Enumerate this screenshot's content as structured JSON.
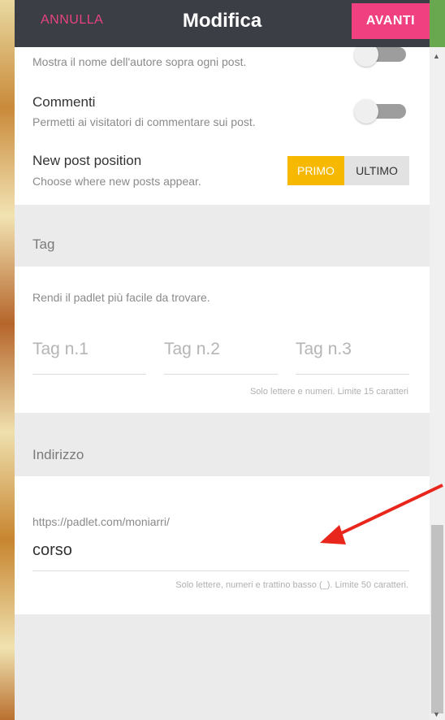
{
  "header": {
    "cancel_label": "ANNULLA",
    "title": "Modifica",
    "next_label": "AVANTI"
  },
  "settings": {
    "author_desc": "Mostra il nome dell'autore sopra ogni post.",
    "comments_title": "Commenti",
    "comments_desc": "Permetti ai visitatori di commentare sui post.",
    "position_title": "New post position",
    "position_desc": "Choose where new posts appear.",
    "position_options": [
      "PRIMO",
      "ULTIMO"
    ],
    "position_selected": "PRIMO"
  },
  "tags": {
    "section_label": "Tag",
    "desc": "Rendi il padlet più facile da trovare.",
    "placeholders": [
      "Tag n.1",
      "Tag n.2",
      "Tag n.3"
    ],
    "hint": "Solo lettere e numeri. Limite 15 caratteri"
  },
  "address": {
    "section_label": "Indirizzo",
    "prefix": "https://padlet.com/moniarri/",
    "value": "corso",
    "hint": "Solo lettere, numeri e trattino basso (_). Limite 50 caratteri."
  },
  "colors": {
    "accent_pink": "#f0407f",
    "accent_yellow": "#f6b800",
    "topbar": "#3b3e45",
    "annotation_arrow": "#e8261c"
  },
  "icons": {
    "scroll_up": "▲",
    "scroll_down": "▼"
  }
}
